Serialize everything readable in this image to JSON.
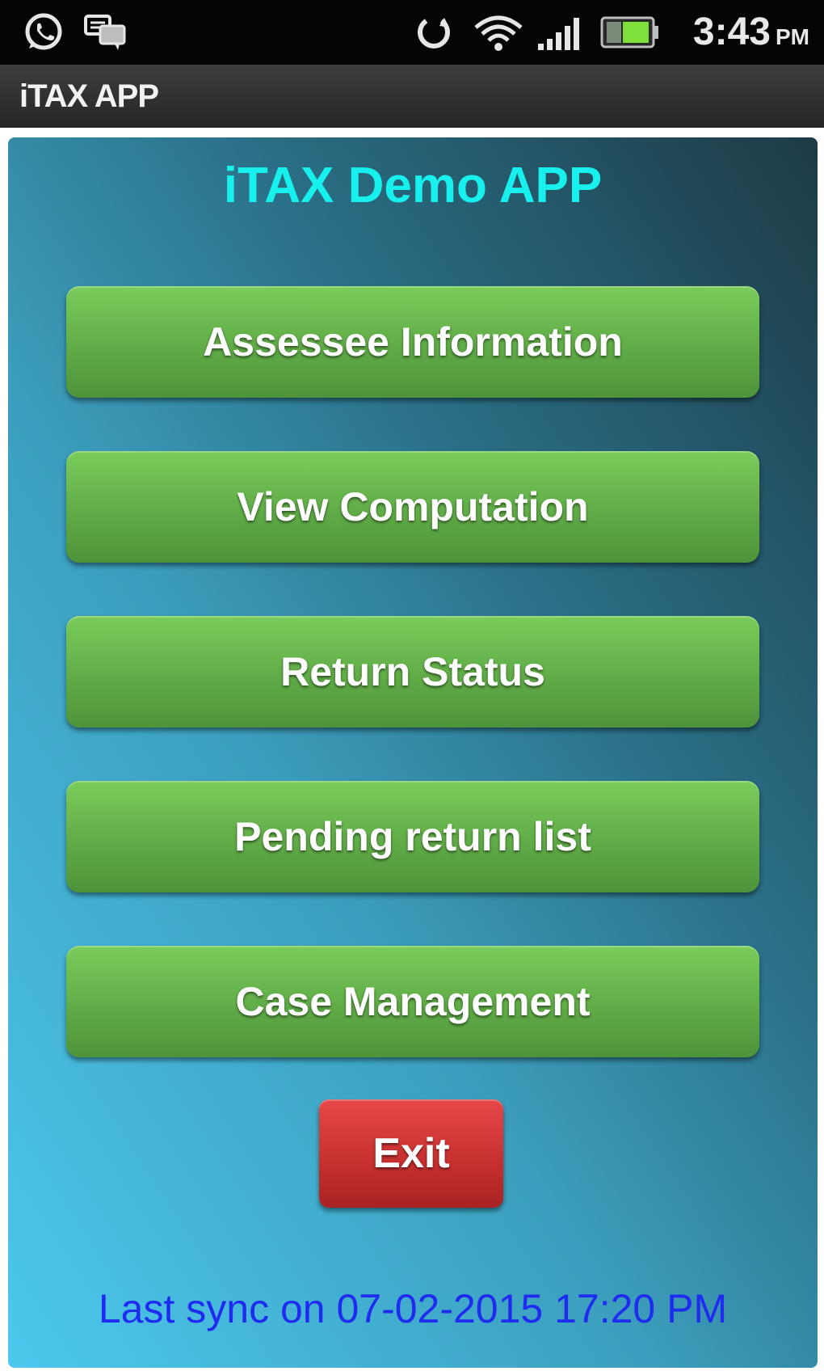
{
  "status_bar": {
    "time": "3:43",
    "ampm": "PM",
    "icons": [
      "whatsapp-icon",
      "chat-icon",
      "sync-icon",
      "wifi-icon",
      "signal-icon",
      "battery-icon"
    ]
  },
  "title_bar": {
    "title": "iTAX APP"
  },
  "main": {
    "app_title": "iTAX Demo APP",
    "buttons": [
      {
        "label": "Assessee Information"
      },
      {
        "label": "View Computation"
      },
      {
        "label": "Return Status"
      },
      {
        "label": "Pending return list"
      },
      {
        "label": "Case Management"
      }
    ],
    "exit_label": "Exit",
    "last_sync": "Last sync on 07-02-2015 17:20 PM"
  },
  "colors": {
    "title_color": "#18f0ee",
    "button_green": "#5ea946",
    "exit_red": "#c62f2f",
    "sync_text_blue": "#1f2cf0"
  }
}
